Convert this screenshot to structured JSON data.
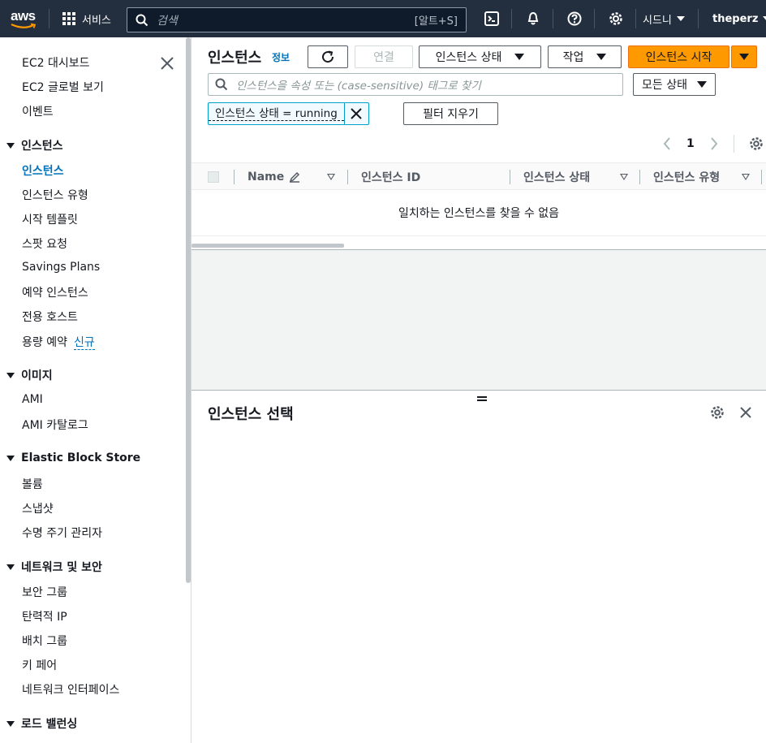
{
  "topnav": {
    "logo_text": "aws",
    "services_label": "서비스",
    "search_placeholder": "검색",
    "search_shortcut": "[알트+S]",
    "region_label": "시드니",
    "user_label": "theperz"
  },
  "sidebar": {
    "top_items": [
      "EC2 대시보드",
      "EC2 글로벌 보기",
      "이벤트"
    ],
    "sections": [
      {
        "title": "인스턴스",
        "items": [
          "인스턴스",
          "인스턴스 유형",
          "시작 템플릿",
          "스팟 요청",
          "Savings Plans",
          "예약 인스턴스",
          "전용 호스트",
          "용량 예약"
        ],
        "active": "인스턴스",
        "new_badge": "신규"
      },
      {
        "title": "이미지",
        "items": [
          "AMI",
          "AMI 카탈로그"
        ]
      },
      {
        "title": "Elastic Block Store",
        "items": [
          "볼륨",
          "스냅샷",
          "수명 주기 관리자"
        ]
      },
      {
        "title": "네트워크 및 보안",
        "items": [
          "보안 그룹",
          "탄력적 IP",
          "배치 그룹",
          "키 페어",
          "네트워크 인터페이스"
        ]
      },
      {
        "title": "로드 밸런싱",
        "items": []
      }
    ]
  },
  "main": {
    "title": "인스턴스",
    "info_link": "정보",
    "connect_label": "연결",
    "state_menu_label": "인스턴스 상태",
    "actions_label": "작업",
    "launch_label": "인스턴스 시작",
    "filter_placeholder": "인스턴스을 속성 또는 (case-sensitive) 태그로 찾기",
    "state_filter_label": "모든 상태",
    "token_label": "인스턴스 상태 = running",
    "clear_filters_label": "필터 지우기",
    "page_number": "1",
    "columns": [
      "Name",
      "인스턴스 ID",
      "인스턴스 상태",
      "인스턴스 유형"
    ],
    "empty_message": "일치하는 인스턴스를 찾을 수 없음",
    "detail_title": "인스턴스 선택"
  },
  "colors": {
    "nav_bg": "#232f3e",
    "accent_blue": "#0073bb",
    "primary_orange": "#ff9900"
  }
}
